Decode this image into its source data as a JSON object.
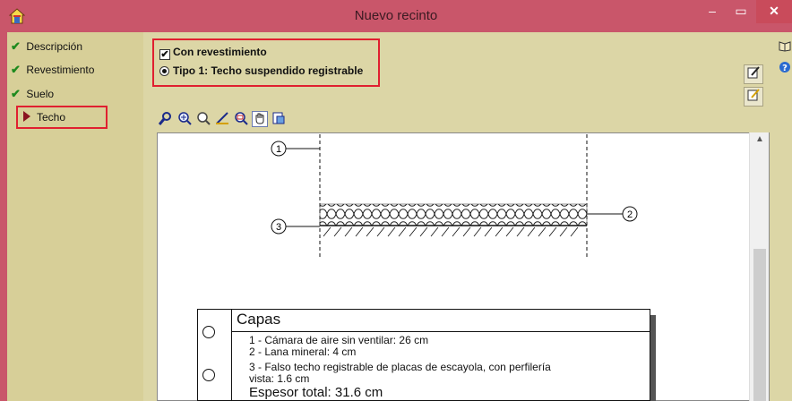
{
  "window": {
    "title": "Nuevo recinto",
    "minimize_glyph": "–",
    "maximize_glyph": "▭",
    "close_glyph": "✕",
    "accent_color": "#c9566a"
  },
  "sidebar": {
    "items": [
      {
        "label": "Descripción",
        "status_icon": "check-icon",
        "selected": false
      },
      {
        "label": "Revestimiento",
        "status_icon": "check-icon",
        "selected": false
      },
      {
        "label": "Suelo",
        "status_icon": "check-icon",
        "selected": false
      },
      {
        "label": "Techo",
        "status_icon": "arrow-right-icon",
        "selected": true
      }
    ]
  },
  "options": {
    "con_revestimiento_label": "Con revestimiento",
    "con_revestimiento_checked": true,
    "tipo_label": "Tipo 1: Techo suspendido registrable",
    "tipo_selected": true
  },
  "toolbar": {
    "icons": [
      "zoom-window-icon",
      "zoom-in-icon",
      "zoom-previous-icon",
      "measure-icon",
      "zoom-extents-icon",
      "pan-hand-icon",
      "print-preview-icon"
    ],
    "active_icon": "pan-hand-icon"
  },
  "drawing": {
    "callouts": [
      "1",
      "2",
      "3"
    ]
  },
  "layers": {
    "title": "Capas",
    "items": [
      "1 - Cámara de aire sin ventilar: 26 cm",
      "2 - Lana mineral: 4 cm",
      "3 - Falso techo registrable de placas de escayola, con perfilería",
      "vista: 1.6 cm"
    ],
    "total": "Espesor total: 31.6 cm"
  }
}
